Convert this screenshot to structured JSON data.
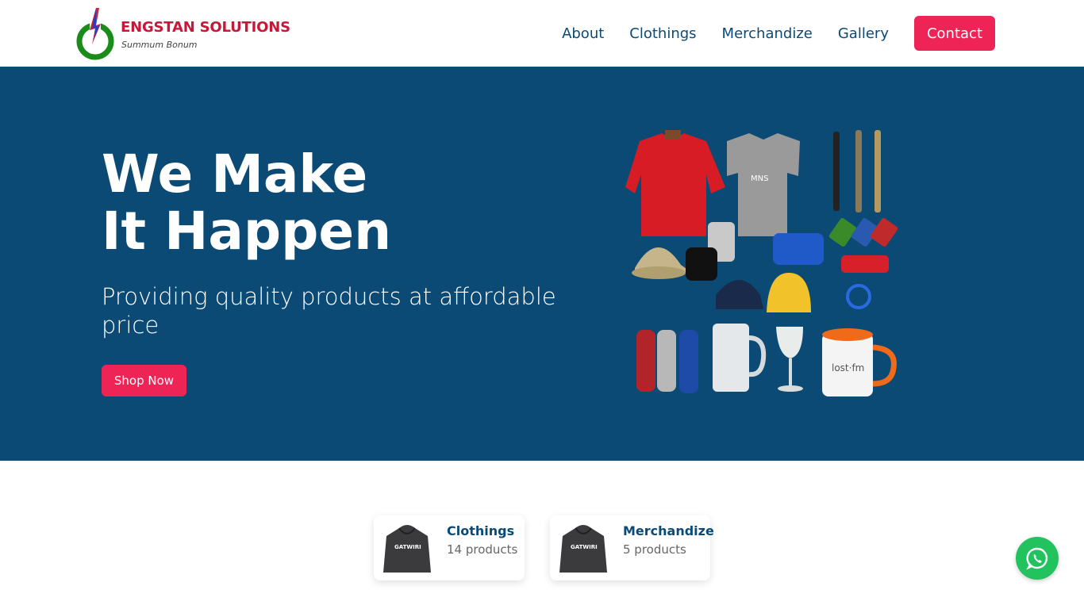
{
  "brand": {
    "name": "ENGSTAN SOLUTIONS",
    "tagline": "Summum Bonum"
  },
  "nav": {
    "links": [
      "About",
      "Clothings",
      "Merchandize",
      "Gallery"
    ],
    "contact": "Contact"
  },
  "hero": {
    "title_line1": "We Make",
    "title_line2": "It Happen",
    "subtitle": "Providing quality products at affordable price",
    "button": "Shop Now"
  },
  "categories": [
    {
      "name": "Clothings",
      "count": "14 products"
    },
    {
      "name": "Merchandize",
      "count": "5 products"
    }
  ],
  "colors": {
    "primary": "#0b4a75",
    "accent": "#ef2456",
    "brand_red": "#c8183a",
    "whatsapp": "#22c35e"
  },
  "icons": {
    "floating_button": "whatsapp-icon"
  }
}
